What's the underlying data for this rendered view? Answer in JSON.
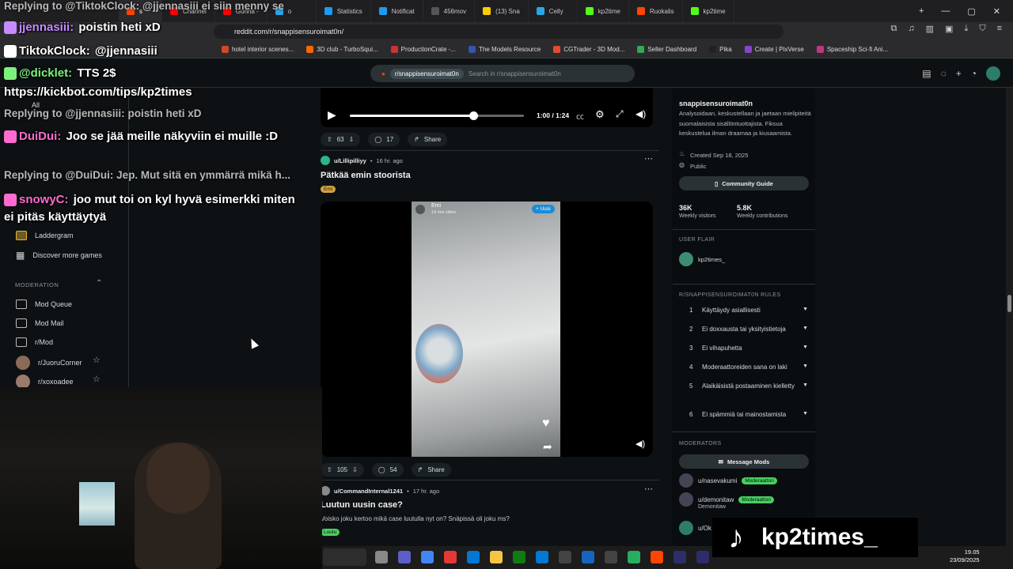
{
  "browser": {
    "tabs": [
      {
        "label": "s",
        "active": true,
        "color": "#ff4500"
      },
      {
        "label": "Channel",
        "color": "#ff0000"
      },
      {
        "label": "Gunna -",
        "color": "#ff0000"
      },
      {
        "label": "o",
        "color": "#27a7e7"
      },
      {
        "label": "Statistics",
        "color": "#1d9bf0"
      },
      {
        "label": "Notificat",
        "color": "#1d9bf0"
      },
      {
        "label": "456mov",
        "color": "#555555"
      },
      {
        "label": "(13) Sna",
        "color": "#ffcc00"
      },
      {
        "label": "Celly",
        "color": "#27a7e7"
      },
      {
        "label": "kp2time",
        "color": "#53fc18"
      },
      {
        "label": "Ruokalis",
        "color": "#ff4500"
      },
      {
        "label": "kp2time",
        "color": "#53fc18"
      }
    ],
    "url": "reddit.com/r/snappisensuroimat0n/",
    "bookmarks": [
      {
        "label": "hotel interior scenes...",
        "color": "#d24726"
      },
      {
        "label": "3D club - TurboSqui...",
        "color": "#ff6600"
      },
      {
        "label": "ProductionCrate -...",
        "color": "#cc3333"
      },
      {
        "label": "The Models Resource",
        "color": "#3355aa"
      },
      {
        "label": "CGTrader - 3D Mod...",
        "color": "#e04c2e"
      },
      {
        "label": "Seller Dashboard",
        "color": "#34a853"
      },
      {
        "label": "Pika",
        "color": "#222222"
      },
      {
        "label": "Create | PixVerse",
        "color": "#8844cc"
      },
      {
        "label": "Spaceship Sci-fi Ani...",
        "color": "#c13584"
      }
    ]
  },
  "reddit": {
    "search_pill": "r/snappisensuroimat0n",
    "search_placeholder": "Search in r/snappisensuroimat0n"
  },
  "sidebar": {
    "all": "All",
    "game_item": "Laddergram",
    "discover": "Discover more games",
    "moderation_header": "MODERATION",
    "mod_items": [
      "Mod Queue",
      "Mod Mail",
      "r/Mod"
    ],
    "communities": [
      "r/JuoruCorner",
      "r/xoxoadee"
    ]
  },
  "video": {
    "time": "1:00 / 1:24",
    "progress": 0.71
  },
  "posts": [
    {
      "votes": "63",
      "comments": "17",
      "share": "Share"
    },
    {
      "author": "u/Lillipilliyy",
      "age": "16 hr. ago",
      "title": "Pätkää emin stoorista",
      "flair": "Emi",
      "media_user": "Emi",
      "media_sub": "14 min sitten",
      "media_follow": "+ Uusi",
      "votes": "105",
      "comments": "54",
      "share": "Share"
    },
    {
      "author": "u/CommandInternal1241",
      "age": "17 hr. ago",
      "title": "Luutun uusin case?",
      "body": "Voisko joku kertoo mikä case luutulla nyt on? Snäpissä oli joku ms?",
      "flair": "Luutu"
    }
  ],
  "community": {
    "name": "snappisensuroimat0n",
    "description": "Analysoidaan, keskustellaan ja jaetaan mielipiteitä suomalaisista sisällöntuottajista. Fiksua keskustelua ilman draamaa ja kiusaamista.",
    "created": "Created Sep 18, 2025",
    "visibility": "Public",
    "guide_button": "Community Guide",
    "visitors": "36K",
    "visitors_label": "Weekly visitors",
    "contributions": "5.8K",
    "contributions_label": "Weekly contributions",
    "user_flair_header": "USER FLAIR",
    "user_flair": "kp2times_",
    "rules_header": "R/SNAPPISENSUROIMAT0N RULES",
    "rules": [
      {
        "num": "1",
        "text": "Käyttäydy asiallisesti"
      },
      {
        "num": "2",
        "text": "Ei doxxausta tai yksityistietoja"
      },
      {
        "num": "3",
        "text": "Ei vihapuhetta"
      },
      {
        "num": "4",
        "text": "Moderaattoreiden sana on laki"
      },
      {
        "num": "5",
        "text": "Alaikäisistä postaaminen kielletty"
      },
      {
        "num": "6",
        "text": "Ei spämmiä tai mainostamista"
      }
    ],
    "moderators_header": "MODERATORS",
    "message_mods": "Message Mods",
    "mods": [
      {
        "name": "u/nasevakumi",
        "badge": "Moderaattori",
        "sub": ""
      },
      {
        "name": "u/demonitaw",
        "badge": "Moderaattori",
        "sub": "Demonitaw"
      },
      {
        "name": "u/Ok",
        "badge": "",
        "sub": ""
      }
    ]
  },
  "chat": [
    {
      "user": "Replying to @TiktokClock:",
      "text": "@jjennasiii ei siin menny se",
      "reply": true
    },
    {
      "user": "jjennasiii:",
      "text": "poistin heti xD",
      "color": "#c58bff"
    },
    {
      "user": "TiktokClock:",
      "text": "@jjennasiii",
      "color": "#ffffff"
    },
    {
      "user": "@dicklet:",
      "text": "TTS 2$",
      "color": "#7cf27c"
    },
    {
      "user": "",
      "text": "https://kickbot.com/tips/kp2times"
    },
    {
      "user": "Replying to @jjennasiii:",
      "text": "poistin heti xD",
      "reply": true
    },
    {
      "user": "DuiDui:",
      "text": "Joo se jää meille näkyviin ei muille :D",
      "color": "#ff6bd0"
    },
    {
      "user": "Replying to @DuiDui:",
      "text": "Jep. Mut sitä en ymmärrä mikä h...",
      "reply": true
    },
    {
      "user": "snowyC:",
      "text": "joo mut toi on kyl hyvä esimerkki miten ei pitäs käyttäytyä",
      "color": "#ff6bd0"
    }
  ],
  "taskbar": {
    "time": "19.05",
    "date": "23/09/2025"
  },
  "stream": {
    "channel": "kp2times_"
  }
}
